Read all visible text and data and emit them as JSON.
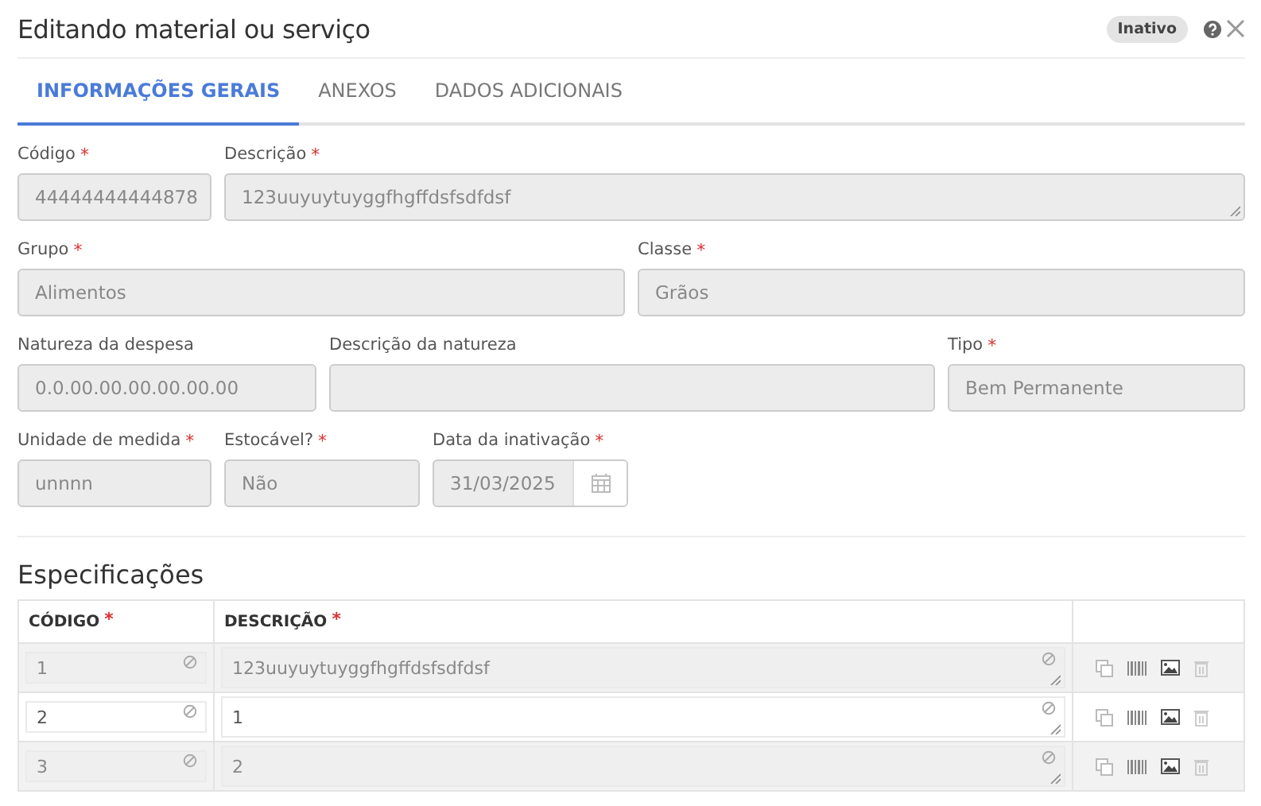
{
  "dialog": {
    "title": "Editando material ou serviço",
    "status_badge": "Inativo"
  },
  "required_mark": "*",
  "tabs": [
    {
      "label": "INFORMAÇÕES GERAIS",
      "selected": true
    },
    {
      "label": "ANEXOS",
      "selected": false
    },
    {
      "label": "DADOS ADICIONAIS",
      "selected": false
    }
  ],
  "field_rows": [
    [
      {
        "label": "Código",
        "required": true,
        "kind": "input",
        "value": "44444444444878",
        "disabled": true
      },
      {
        "label": "Descrição",
        "required": true,
        "kind": "textarea",
        "value": "123uuyuytuyggfhgffdsfsdfdsf",
        "disabled": true
      }
    ],
    [
      {
        "label": "Grupo",
        "required": true,
        "kind": "input",
        "value": "Alimentos",
        "disabled": true
      },
      {
        "label": "Classe",
        "required": true,
        "kind": "input",
        "value": "Grãos",
        "disabled": true
      }
    ],
    [
      {
        "label": "Natureza da despesa",
        "required": false,
        "kind": "input",
        "value": "0.0.00.00.00.00.00.00",
        "disabled": true
      },
      {
        "label": "Descrição da natureza",
        "required": false,
        "kind": "input",
        "disabled": true
      },
      {
        "label": "Tipo",
        "required": true,
        "kind": "input",
        "value": "Bem Permanente",
        "disabled": true
      }
    ],
    [
      {
        "label": "Unidade de medida",
        "required": true,
        "kind": "input",
        "value": "unnnn",
        "disabled": true
      },
      {
        "label": "Estocável?",
        "required": true,
        "kind": "input",
        "value": "Não",
        "disabled": true
      },
      {
        "label": "Data da inativação",
        "required": true,
        "kind": "date",
        "value": "31/03/2025",
        "disabled": true
      }
    ]
  ],
  "specifications": {
    "title": "Especificações",
    "columns": [
      {
        "label": "CÓDIGO",
        "required": true
      },
      {
        "label": "DESCRIÇÃO",
        "required": true
      }
    ],
    "rows": [
      {
        "codigo": "1",
        "descricao": "123uuyuytuyggfhgffdsfsdfdsf",
        "disabled": true
      },
      {
        "codigo": "2",
        "descricao": "1",
        "disabled": false
      },
      {
        "codigo": "3",
        "descricao": "2",
        "disabled": true
      }
    ]
  }
}
